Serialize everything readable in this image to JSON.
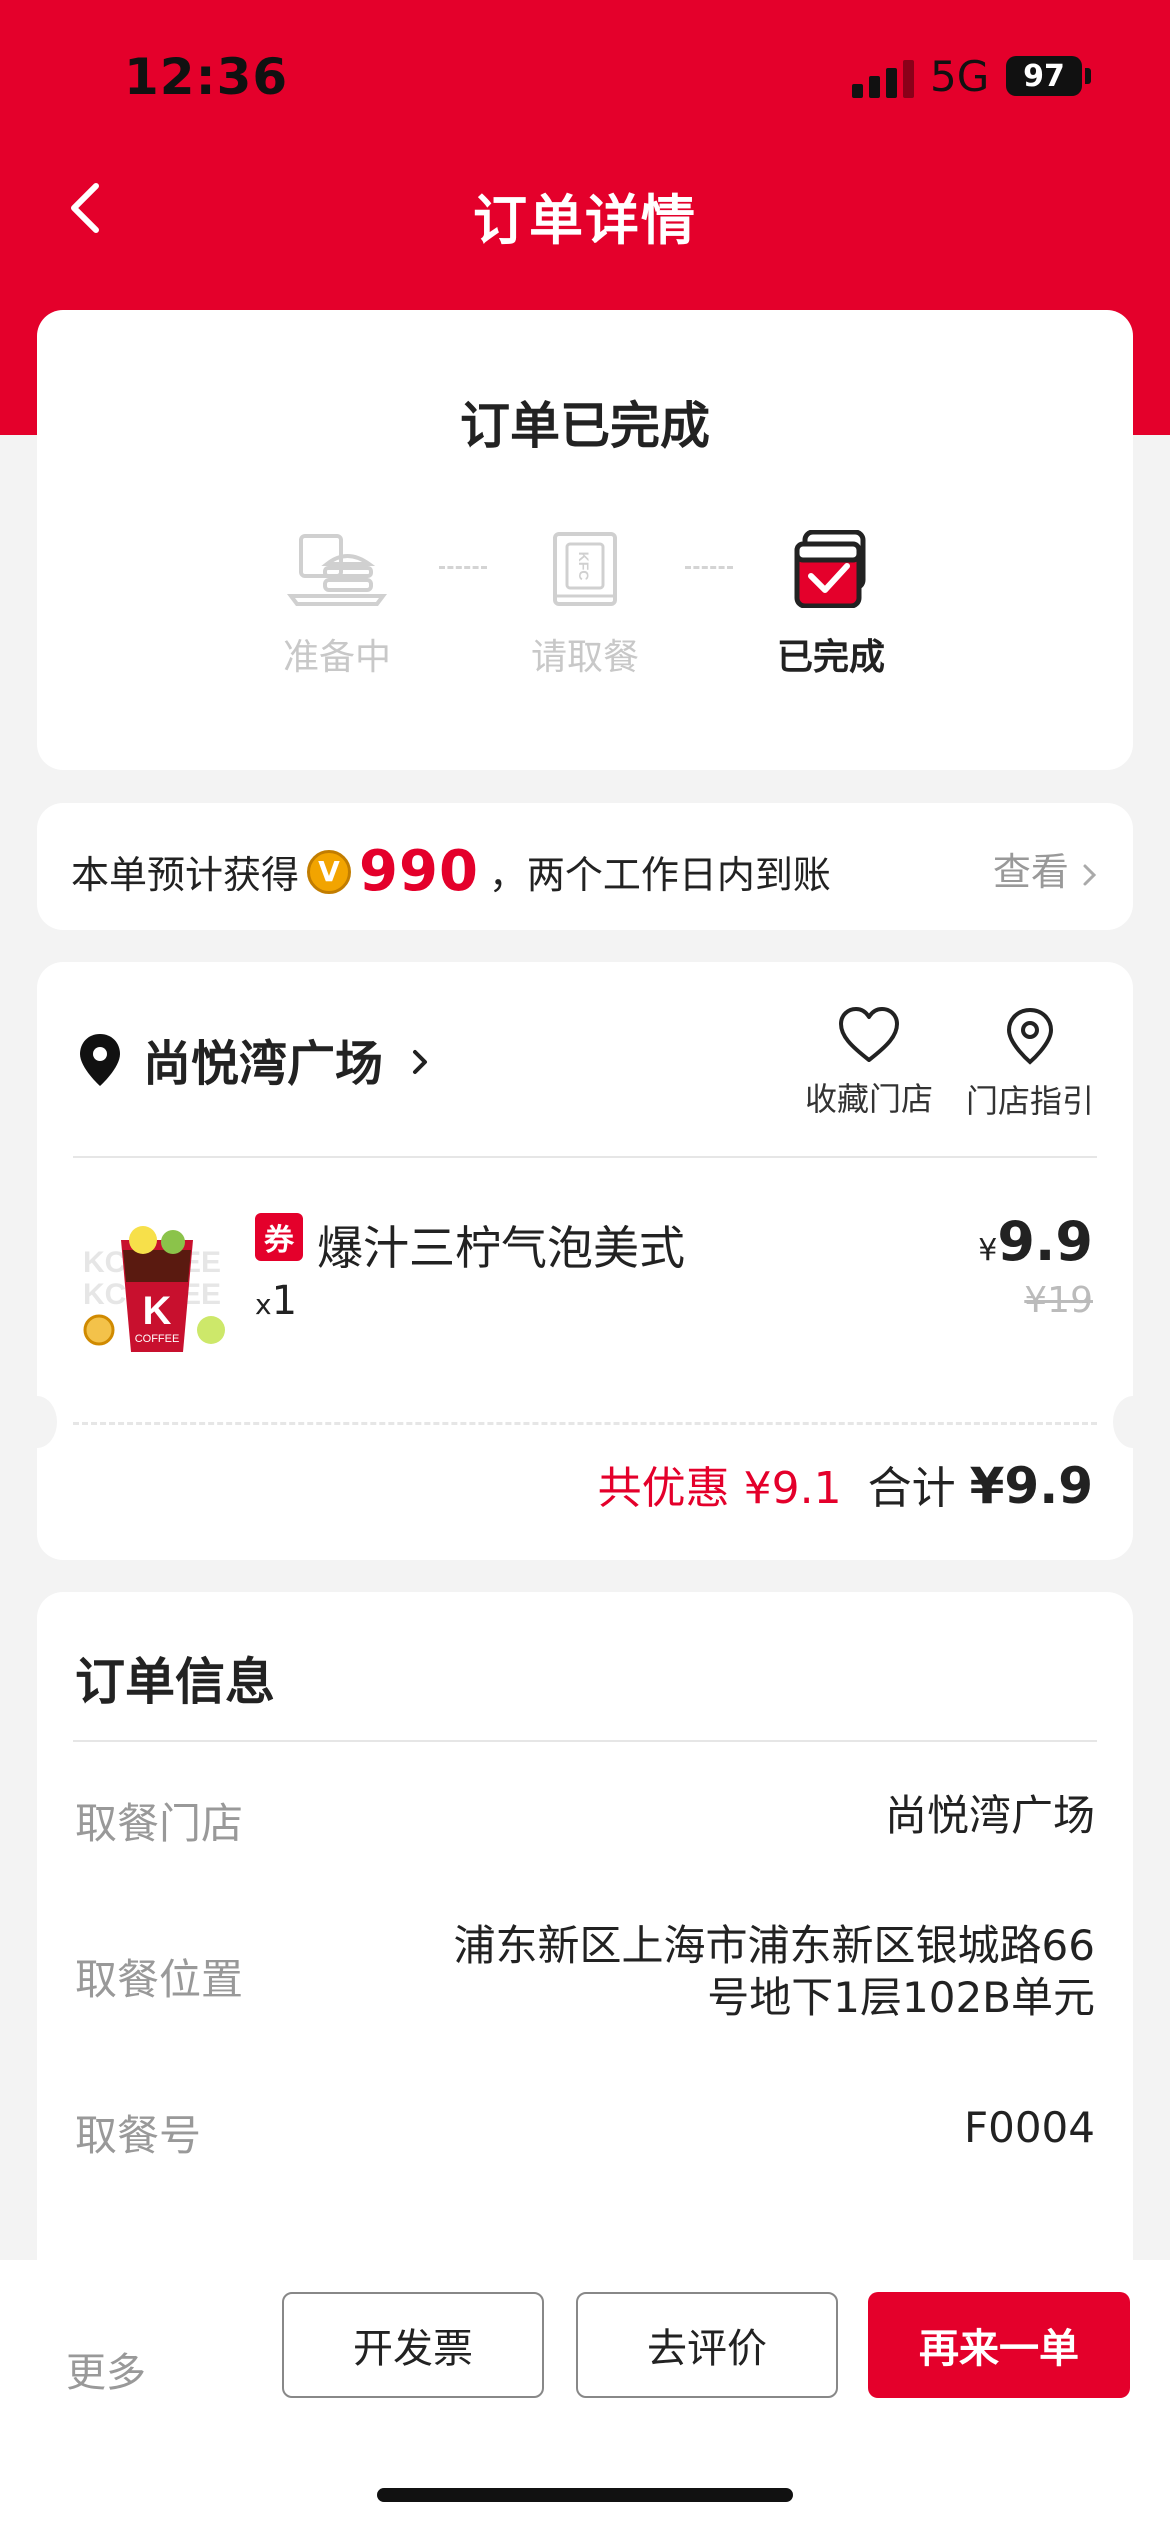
{
  "status_bar": {
    "time": "12:36",
    "network": "5G",
    "battery": "97"
  },
  "nav": {
    "title": "订单详情"
  },
  "order_status": {
    "title": "订单已完成",
    "steps": [
      {
        "label": "准备中",
        "icon": "burger-tray-icon",
        "active": false
      },
      {
        "label": "请取餐",
        "icon": "kfc-bag-icon",
        "active": false
      },
      {
        "label": "已完成",
        "icon": "completed-check-icon",
        "active": true
      }
    ]
  },
  "points": {
    "prefix": "本单预计获得",
    "badge": "V",
    "amount": "990",
    "suffix": "，两个工作日内到账",
    "view_label": "查看",
    "accent": "#e4002b"
  },
  "store": {
    "name": "尚悦湾广场",
    "favorite_label": "收藏门店",
    "directions_label": "门店指引"
  },
  "items": [
    {
      "coupon_tag": "券",
      "name": "爆汁三柠气泡美式",
      "qty_prefix": "x",
      "qty": "1",
      "currency": "¥",
      "price": "9.9",
      "original_price": "¥19"
    }
  ],
  "totals": {
    "discount_label": "共优惠 ¥9.1",
    "total_label": "合计",
    "total_value": "¥9.9"
  },
  "order_info": {
    "title": "订单信息",
    "rows": [
      {
        "label": "取餐门店",
        "value": "尚悦湾广场"
      },
      {
        "label": "取餐位置",
        "value_line1": "浦东新区上海市浦东新区银城路66",
        "value_line2": "号地下1层102B单元"
      },
      {
        "label": "取餐号",
        "value": "F0004"
      }
    ]
  },
  "bottom_bar": {
    "more_label": "更多",
    "invoice_label": "开发票",
    "review_label": "去评价",
    "reorder_label": "再来一单"
  },
  "colors": {
    "brand_red": "#e4002b",
    "background": "#f3f3f3"
  }
}
